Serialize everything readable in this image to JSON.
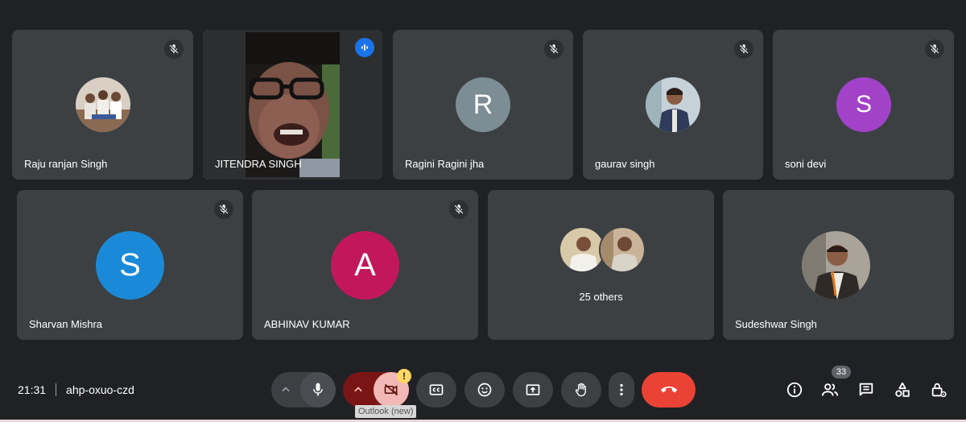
{
  "participants": [
    {
      "name": "Raju ranjan Singh"
    },
    {
      "name": "JITENDRA SINGH"
    },
    {
      "name": "Ragini Ragini jha",
      "initial": "R"
    },
    {
      "name": "gaurav singh"
    },
    {
      "name": "soni devi",
      "initial": "S"
    },
    {
      "name": "Sharvan Mishra",
      "initial": "S"
    },
    {
      "name": "ABHINAV KUMAR",
      "initial": "A"
    },
    {
      "name": "25 others"
    },
    {
      "name": "Sudeshwar Singh"
    }
  ],
  "colors": {
    "ragini": "#7c8d94",
    "soni": "#a142c8",
    "sharvan": "#1a8ad8",
    "abhinav": "#c2185b",
    "speaking_border": "#8ab4f8",
    "end_call": "#ea4335",
    "camera_off": "#7a1515"
  },
  "meeting": {
    "time": "21:31",
    "code": "ahp-oxuo-czd"
  },
  "controls": {
    "people_count": "33",
    "tooltip": "Outlook (new)",
    "warning_glyph": "!"
  },
  "icons": [
    "mic-off-icon",
    "audio-wave-icon",
    "chevron-up-icon",
    "mic-icon",
    "camera-off-icon",
    "captions-icon",
    "emoji-icon",
    "present-icon",
    "hand-icon",
    "more-vert-icon",
    "call-end-icon",
    "info-icon",
    "people-icon",
    "chat-icon",
    "activities-icon",
    "host-controls-icon"
  ]
}
